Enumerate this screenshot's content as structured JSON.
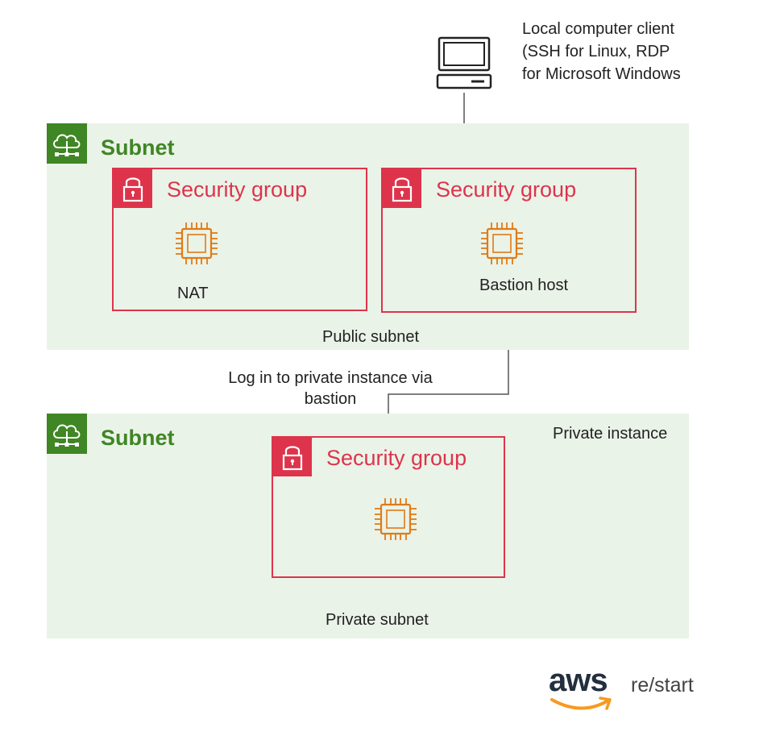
{
  "client": {
    "label_lines": [
      "Local computer client",
      "(SSH for Linux, RDP",
      "for Microsoft Windows"
    ]
  },
  "public_subnet": {
    "title": "Subnet",
    "caption": "Public subnet",
    "groups": [
      {
        "title": "Security group",
        "instance_label": "NAT"
      },
      {
        "title": "Security group",
        "instance_label": "Bastion host"
      }
    ]
  },
  "connection": {
    "label_lines": [
      "Log in to private instance via",
      "bastion"
    ]
  },
  "private_subnet": {
    "title": "Subnet",
    "caption": "Private subnet",
    "instance_caption": "Private instance",
    "group": {
      "title": "Security group"
    }
  },
  "brand": {
    "logo_text": "aws",
    "suffix": "re/start"
  },
  "colors": {
    "subnet_green": "#3f8624",
    "subnet_fill": "#eaf3e8",
    "security_red": "#dd344c",
    "instance_orange": "#e07b17",
    "aws_smile": "#f79a1e"
  },
  "icons": [
    "computer-icon",
    "cloud-network-icon",
    "padlock-icon",
    "chip-icon",
    "aws-smile-icon"
  ]
}
